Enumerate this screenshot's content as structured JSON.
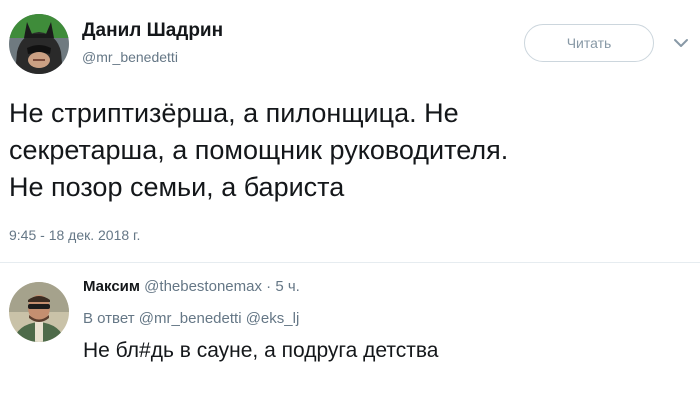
{
  "tweet": {
    "author_name": "Данил Шадрин",
    "author_handle": "@mr_benedetti",
    "follow_label": "Читать",
    "text_lines": [
      "Не стриптизёрша, а пилонщица. Не",
      "секретарша, а помощник руководителя.",
      "Не позор семьи, а бариста"
    ],
    "timestamp": "9:45 - 18 дек. 2018 г.",
    "avatar_icon": "batman-avatar-icon",
    "menu_icon": "chevron-down-icon"
  },
  "reply": {
    "author_name": "Максим",
    "author_handle": "@thebestonemax",
    "separator": "·",
    "age": "5 ч.",
    "reply_to_prefix": "В ответ",
    "reply_to_handles": [
      "@mr_benedetti",
      "@eks_lj"
    ],
    "text": "Не бл#дь в сауне, а подруга детства",
    "avatar_icon": "user-photo-avatar-icon"
  },
  "colors": {
    "text_primary": "#14171a",
    "text_secondary": "#657786",
    "border": "#ccd6dd",
    "button_text": "#8899a6"
  }
}
